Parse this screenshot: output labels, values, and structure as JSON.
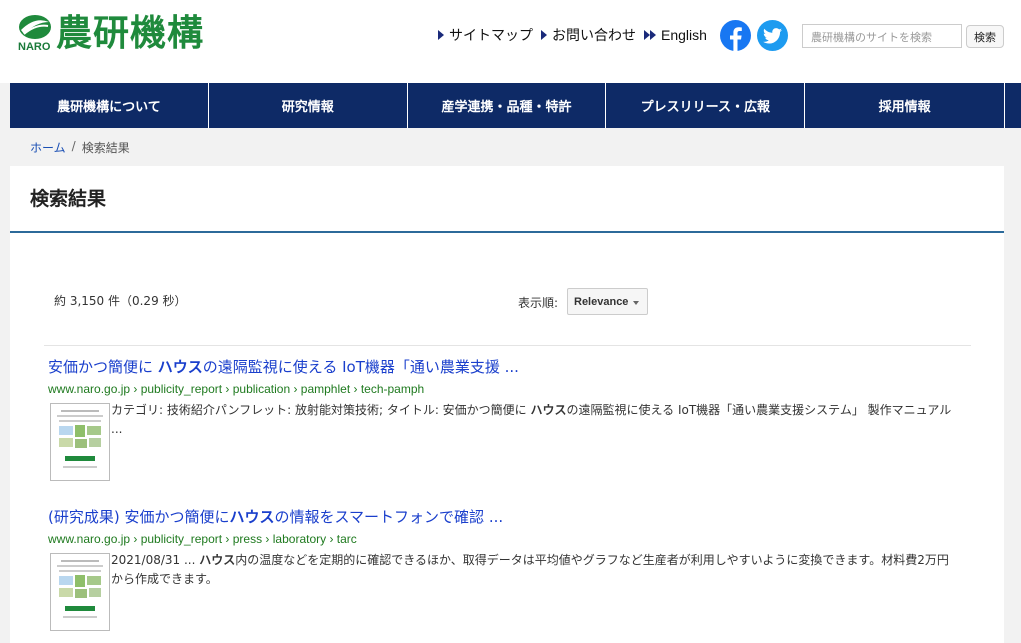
{
  "header": {
    "logo_naro": "NARO",
    "logo_text": "農研機構",
    "links": [
      {
        "label": "サイトマップ"
      },
      {
        "label": "お問い合わせ"
      },
      {
        "label": "English"
      }
    ],
    "search_placeholder": "農研機構のサイトを検索",
    "search_button": "検索"
  },
  "nav": {
    "items": [
      {
        "label": "農研機構について"
      },
      {
        "label": "研究情報"
      },
      {
        "label": "産学連携・品種・特許"
      },
      {
        "label": "プレスリリース・広報"
      },
      {
        "label": "採用情報"
      }
    ]
  },
  "breadcrumb": {
    "home": "ホーム",
    "sep": "/",
    "current": "検索結果"
  },
  "main": {
    "title": "検索結果",
    "result_count": "約 3,150 件（0.29 秒）",
    "sort_label": "表示順:",
    "sort_value": "Relevance",
    "results": [
      {
        "title_pre": "安価かつ簡便に ",
        "title_hl": "ハウス",
        "title_post": "の遠隔監視に使える IoT機器「通い農業支援 ...",
        "url": "www.naro.go.jp › publicity_report › publication › pamphlet › tech-pamph",
        "snippet_pre": "カテゴリ: 技術紹介パンフレット: 放射能対策技術; タイトル: 安価かつ簡便に ",
        "snippet_hl": "ハウス",
        "snippet_post": "の遠隔監視に使える IoT機器「通い農業支援システム」 製作マニュアル ..."
      },
      {
        "title_pre": "(研究成果) 安価かつ簡便に",
        "title_hl": "ハウス",
        "title_post": "の情報をスマートフォンで確認 ...",
        "url": "www.naro.go.jp › publicity_report › press › laboratory › tarc",
        "snippet_pre": "2021/08/31 ... ",
        "snippet_hl": "ハウス",
        "snippet_post": "内の温度などを定期的に確認できるほか、取得データは平均値やグラフなど生産者が利用しやすいように変換できます。材料費2万円から作成できます。"
      }
    ]
  },
  "colors": {
    "nav_bg": "#0e2a66",
    "logo_green": "#1f8a3c",
    "link_blue": "#1a3fcc",
    "url_green": "#1f7a1f",
    "facebook": "#1877f2",
    "twitter": "#1d9bf0"
  },
  "icons": [
    "facebook-icon",
    "twitter-icon",
    "triangle-right-icon",
    "double-triangle-right-icon",
    "chevron-down-icon"
  ]
}
